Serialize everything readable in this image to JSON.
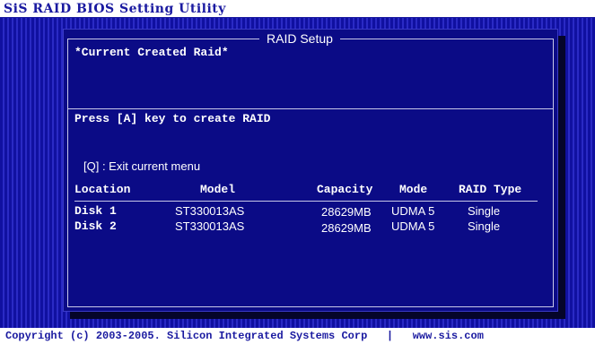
{
  "app": {
    "title": "SiS RAID BIOS Setting Utility"
  },
  "panel": {
    "title": "RAID Setup",
    "current_created": "*Current Created Raid*",
    "press_hint": "Press [A] key to create RAID",
    "exit_hint": "[Q] : Exit current menu"
  },
  "table": {
    "headers": [
      "Location",
      "Model",
      "Capacity",
      "Mode",
      "RAID Type"
    ],
    "rows": [
      [
        "Disk 1",
        "ST330013AS",
        "28629MB",
        "UDMA 5",
        "Single"
      ],
      [
        "Disk 2",
        "ST330013AS",
        "28629MB",
        "UDMA 5",
        "Single"
      ]
    ]
  },
  "footer": {
    "copyright": "Copyright (c) 2003-2005. Silicon Integrated Systems Corp",
    "separator": "|",
    "url": "www.sis.com"
  },
  "colors": {
    "background": "#1717a8",
    "panel": "#0b0b86",
    "text": "#ffffff",
    "title_text": "#1a1aa0"
  }
}
